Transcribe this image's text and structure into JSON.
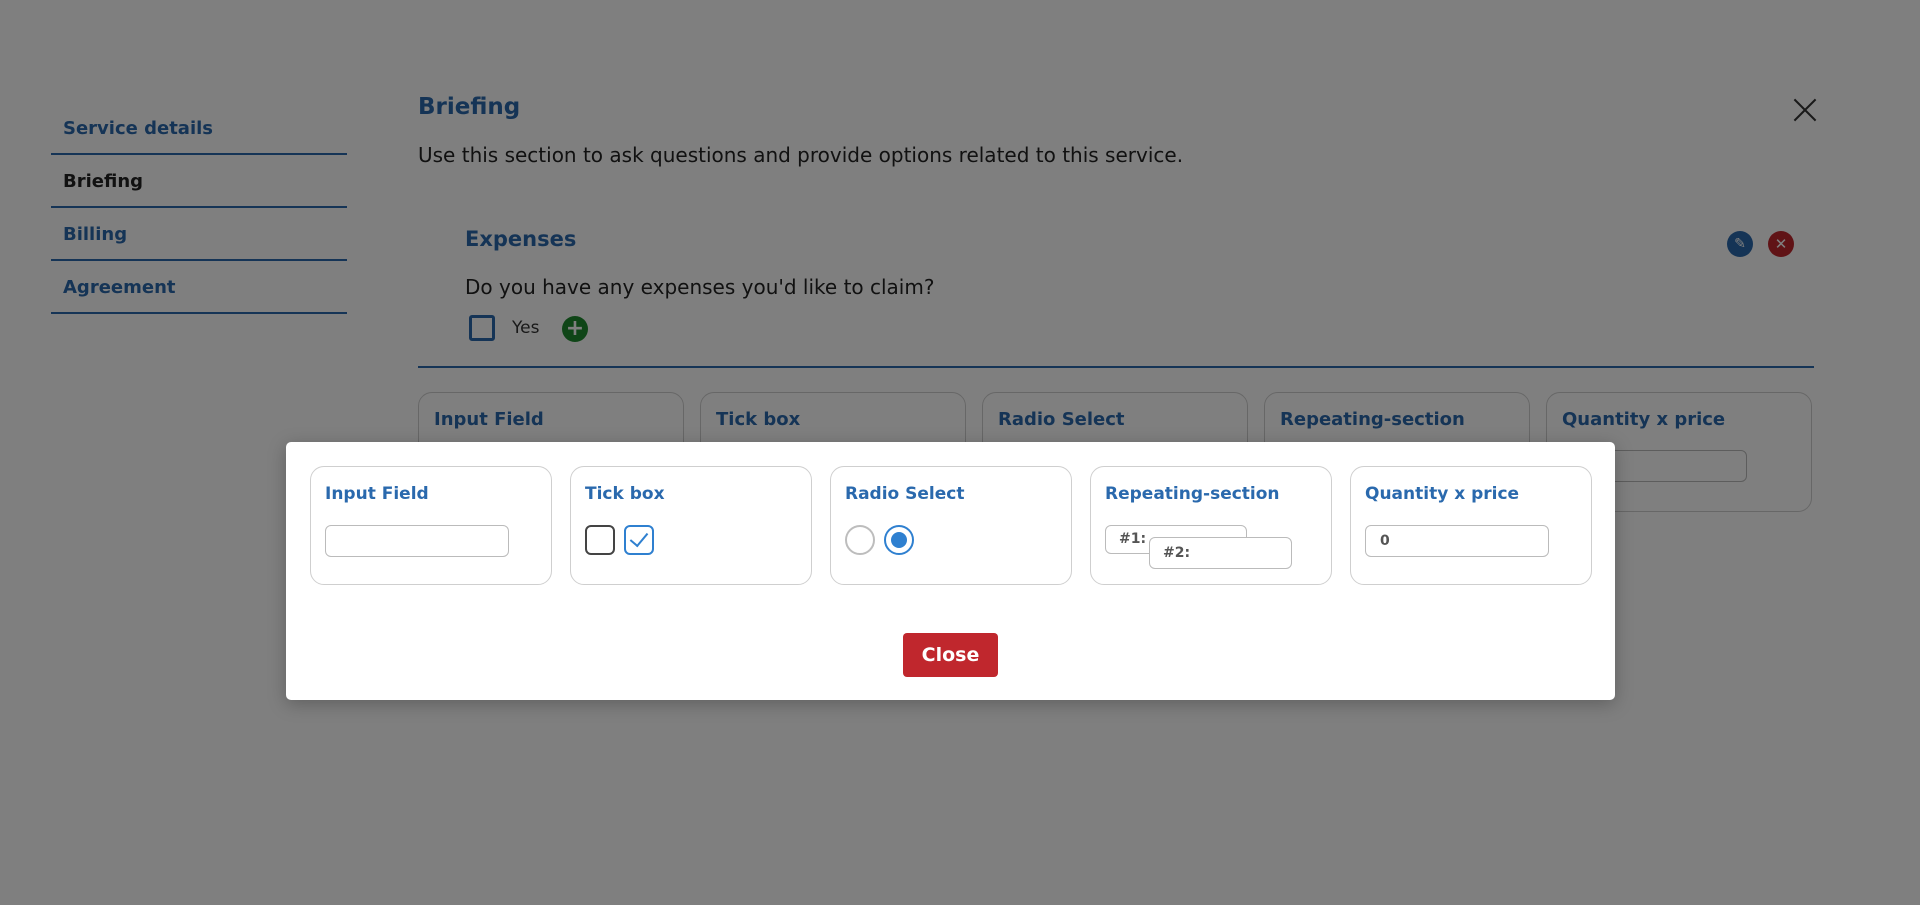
{
  "sidebar": {
    "items": [
      {
        "label": "Service details"
      },
      {
        "label": "Briefing"
      },
      {
        "label": "Billing"
      },
      {
        "label": "Agreement"
      }
    ]
  },
  "panel": {
    "title": "Briefing",
    "description": "Use this section to ask questions and provide options related to this service.",
    "close_icon": "close-icon"
  },
  "expenses": {
    "title": "Expenses",
    "question": "Do you have any expenses you'd like to claim?",
    "option_label": "Yes",
    "edit_icon": "pencil-icon",
    "delete_icon": "close-circle-icon",
    "add_icon": "plus-circle-icon"
  },
  "field_types": [
    {
      "title": "Input Field"
    },
    {
      "title": "Tick box"
    },
    {
      "title": "Radio Select"
    },
    {
      "title": "Repeating-section"
    },
    {
      "title": "Quantity x price"
    }
  ],
  "modal": {
    "cards": {
      "input_field": {
        "title": "Input Field"
      },
      "tick_box": {
        "title": "Tick box"
      },
      "radio_select": {
        "title": "Radio Select"
      },
      "repeating_section": {
        "title": "Repeating-section",
        "item1": "#1:",
        "item2": "#2:"
      },
      "quantity_price": {
        "title": "Quantity x price",
        "value": "0"
      }
    },
    "close_label": "Close"
  },
  "colors": {
    "accent": "#2a69ad",
    "danger": "#c0272d",
    "success": "#1f8a2e",
    "overlay": "rgba(0,0,0,0.5)"
  }
}
